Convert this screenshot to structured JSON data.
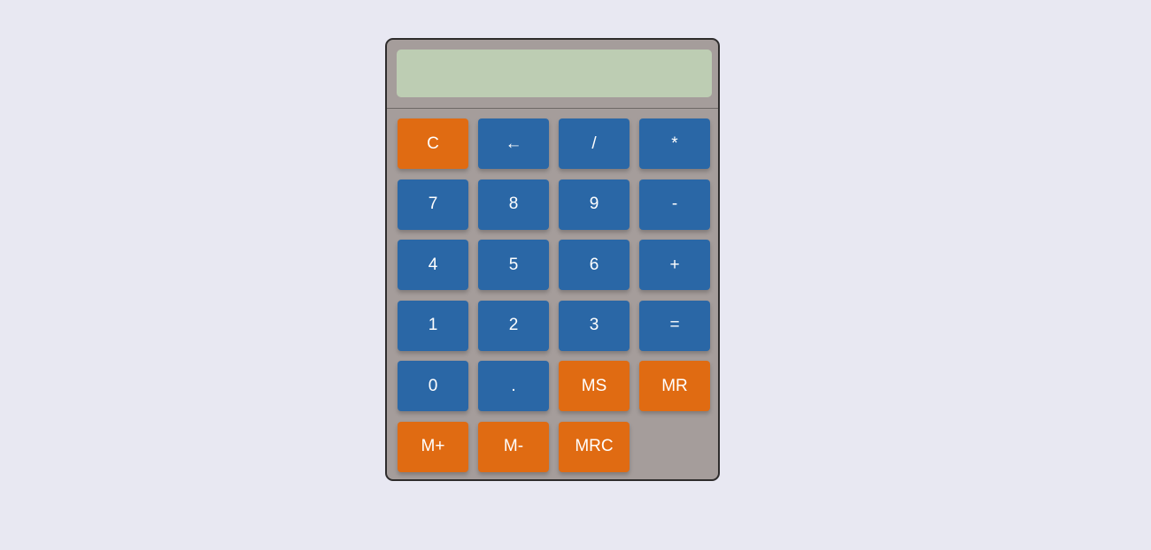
{
  "display": {
    "value": ""
  },
  "colors": {
    "operator_key": "#2a67a6",
    "function_key": "#e06b12",
    "display_bg": "#bdcdb3",
    "body_bg": "#a59d9b",
    "page_bg": "#e8e8f2"
  },
  "keys": {
    "clear": "C",
    "backspace": "←",
    "divide": "/",
    "multiply": "*",
    "seven": "7",
    "eight": "8",
    "nine": "9",
    "minus": "-",
    "four": "4",
    "five": "5",
    "six": "6",
    "plus": "+",
    "one": "1",
    "two": "2",
    "three": "3",
    "equals": "=",
    "zero": "0",
    "decimal": ".",
    "memory_store": "MS",
    "memory_recall": "MR",
    "memory_add": "M+",
    "memory_subtract": "M-",
    "memory_recall_clear": "MRC"
  }
}
